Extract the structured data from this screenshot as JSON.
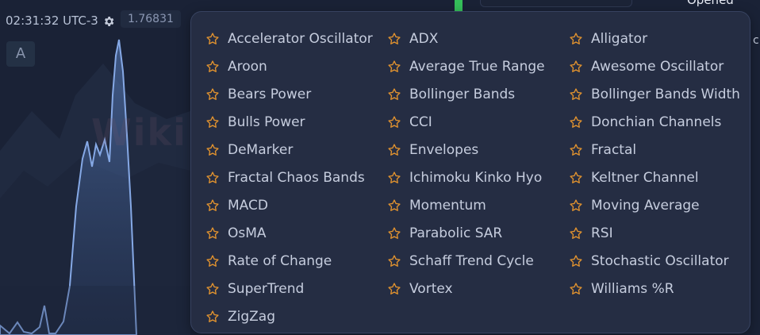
{
  "header": {
    "time": "02:31:32 UTC-3",
    "price": "1.76831",
    "chart_type_button": "A",
    "status_label": "Opened"
  },
  "indicators_menu": {
    "columns": [
      [
        "Accelerator Oscillator",
        "Aroon",
        "Bears Power",
        "Bulls Power",
        "DeMarker",
        "Fractal Chaos Bands",
        "MACD",
        "OsMA",
        "Rate of Change",
        "SuperTrend",
        "ZigZag"
      ],
      [
        "ADX",
        "Average True Range",
        "Bollinger Bands",
        "CCI",
        "Envelopes",
        "Ichimoku Kinko Hyo",
        "Momentum",
        "Parabolic SAR",
        "Schaff Trend Cycle",
        "Vortex"
      ],
      [
        "Alligator",
        "Awesome Oscillator",
        "Bollinger Bands Width",
        "Donchian Channels",
        "Fractal",
        "Keltner Channel",
        "Moving Average",
        "RSI",
        "Stochastic Oscillator",
        "Williams %R"
      ]
    ],
    "star_icon": "star-outline-icon",
    "star_color": "#e0922f"
  },
  "watermark": [
    "WikiFX",
    "WikiFX"
  ],
  "colors": {
    "background": "#1a2236",
    "panel": "#252d43",
    "text": "#c6cdde",
    "chart_line": "#7aa0e0",
    "green_marker": "#35c05a"
  }
}
